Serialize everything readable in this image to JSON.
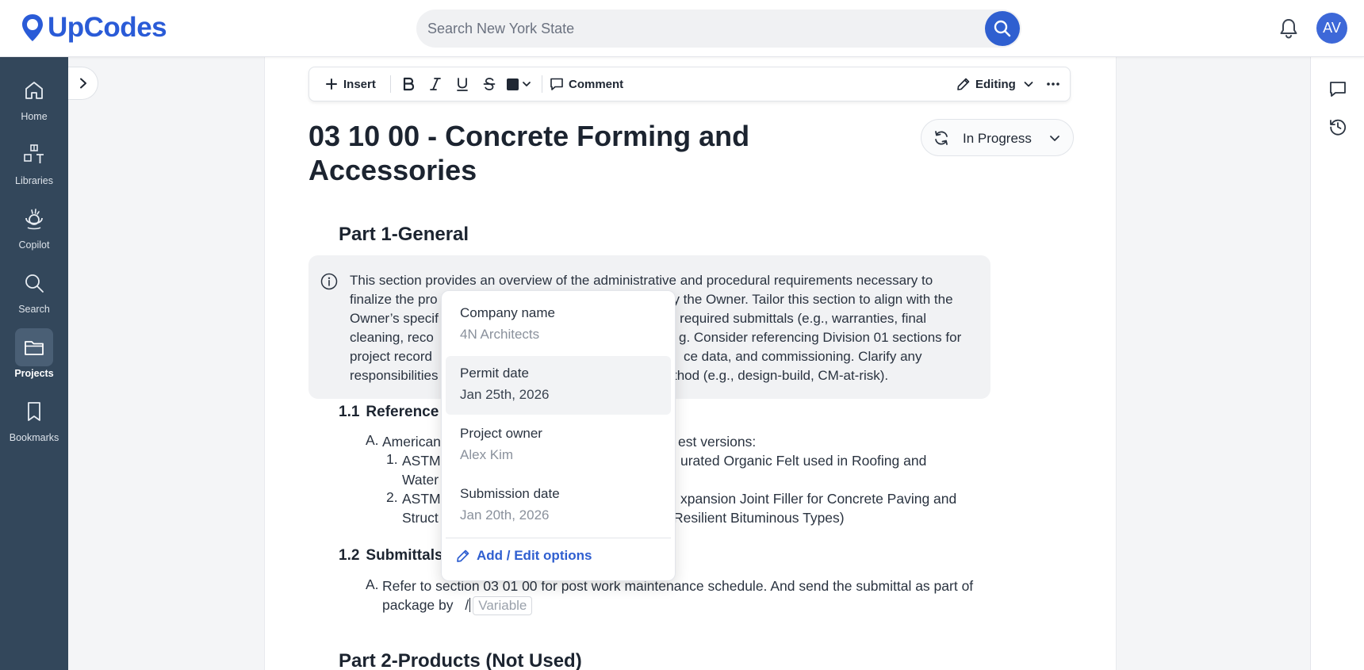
{
  "header": {
    "logo_text": "UpCodes",
    "search_placeholder": "Search New York State",
    "avatar_initials": "AV"
  },
  "sidebar": {
    "items": [
      {
        "label": "Home"
      },
      {
        "label": "Libraries"
      },
      {
        "label": "Copilot"
      },
      {
        "label": "Search"
      },
      {
        "label": "Projects"
      },
      {
        "label": "Bookmarks"
      }
    ],
    "active": "Projects"
  },
  "toolbar": {
    "insert_label": "Insert",
    "comment_label": "Comment",
    "editing_label": "Editing"
  },
  "document": {
    "title": "03 10 00 - Concrete Forming and Accessories",
    "status": "In Progress",
    "part1_heading": "Part 1-General",
    "info_text": "This section provides an overview of the administrative and procedural requirements necessary to finalize the pro                                             by the Owner. Tailor this section to align with the Owner’s specif",
    "info_lines": [
      "This section provides an overview of the administrative and procedural requirements necessary to",
      "finalize the pro",
      "by the Owner. Tailor this section to align with the",
      "Owner’s specif",
      "g required submittals (e.g., warranties, final",
      "cleaning, reco",
      "g. Consider referencing Division 01 sections for",
      "project record",
      "ce data, and commissioning. Clarify any",
      "responsibilities",
      "thod (e.g., design-build, CM-at-risk)."
    ],
    "s11_num": "1.1",
    "s11_title": "Reference",
    "s11_a_marker": "A.",
    "s11_a_start": "American",
    "s11_a_end": "est versions:",
    "s11_1_marker": "1.",
    "s11_1_start": "ASTM",
    "s11_1_end": "urated Organic Felt used in Roofing and",
    "s11_1_line2": "Water",
    "s11_2_marker": "2.",
    "s11_2_start": "ASTM",
    "s11_2_end": "xpansion Joint Filler for Concrete Paving and",
    "s11_2_line2_start": "Struct",
    "s11_2_line2_end": "Resilient Bituminous Types)",
    "s12_num": "1.2",
    "s12_title": "Submittals",
    "s12_a_marker": "A.",
    "s12_a_line1": "Refer to section 03 01 00 for post work maintenance schedule. And send the submittal as part of",
    "s12_a_line2": "package by",
    "slash": "/",
    "variable_placeholder": "Variable",
    "part2_heading": "Part 2-Products (Not Used)"
  },
  "variable_popup": {
    "options": [
      {
        "name": "Company name",
        "value": "4N Architects"
      },
      {
        "name": "Permit date",
        "value": "Jan 25th, 2026"
      },
      {
        "name": "Project owner",
        "value": "Alex Kim"
      },
      {
        "name": "Submission date",
        "value": "Jan 20th, 2026"
      }
    ],
    "highlighted_index": 1,
    "edit_label": "Add / Edit options"
  },
  "colors": {
    "brand": "#2a5bd7",
    "sidebar": "#33475b",
    "link": "#2f5fd0"
  }
}
